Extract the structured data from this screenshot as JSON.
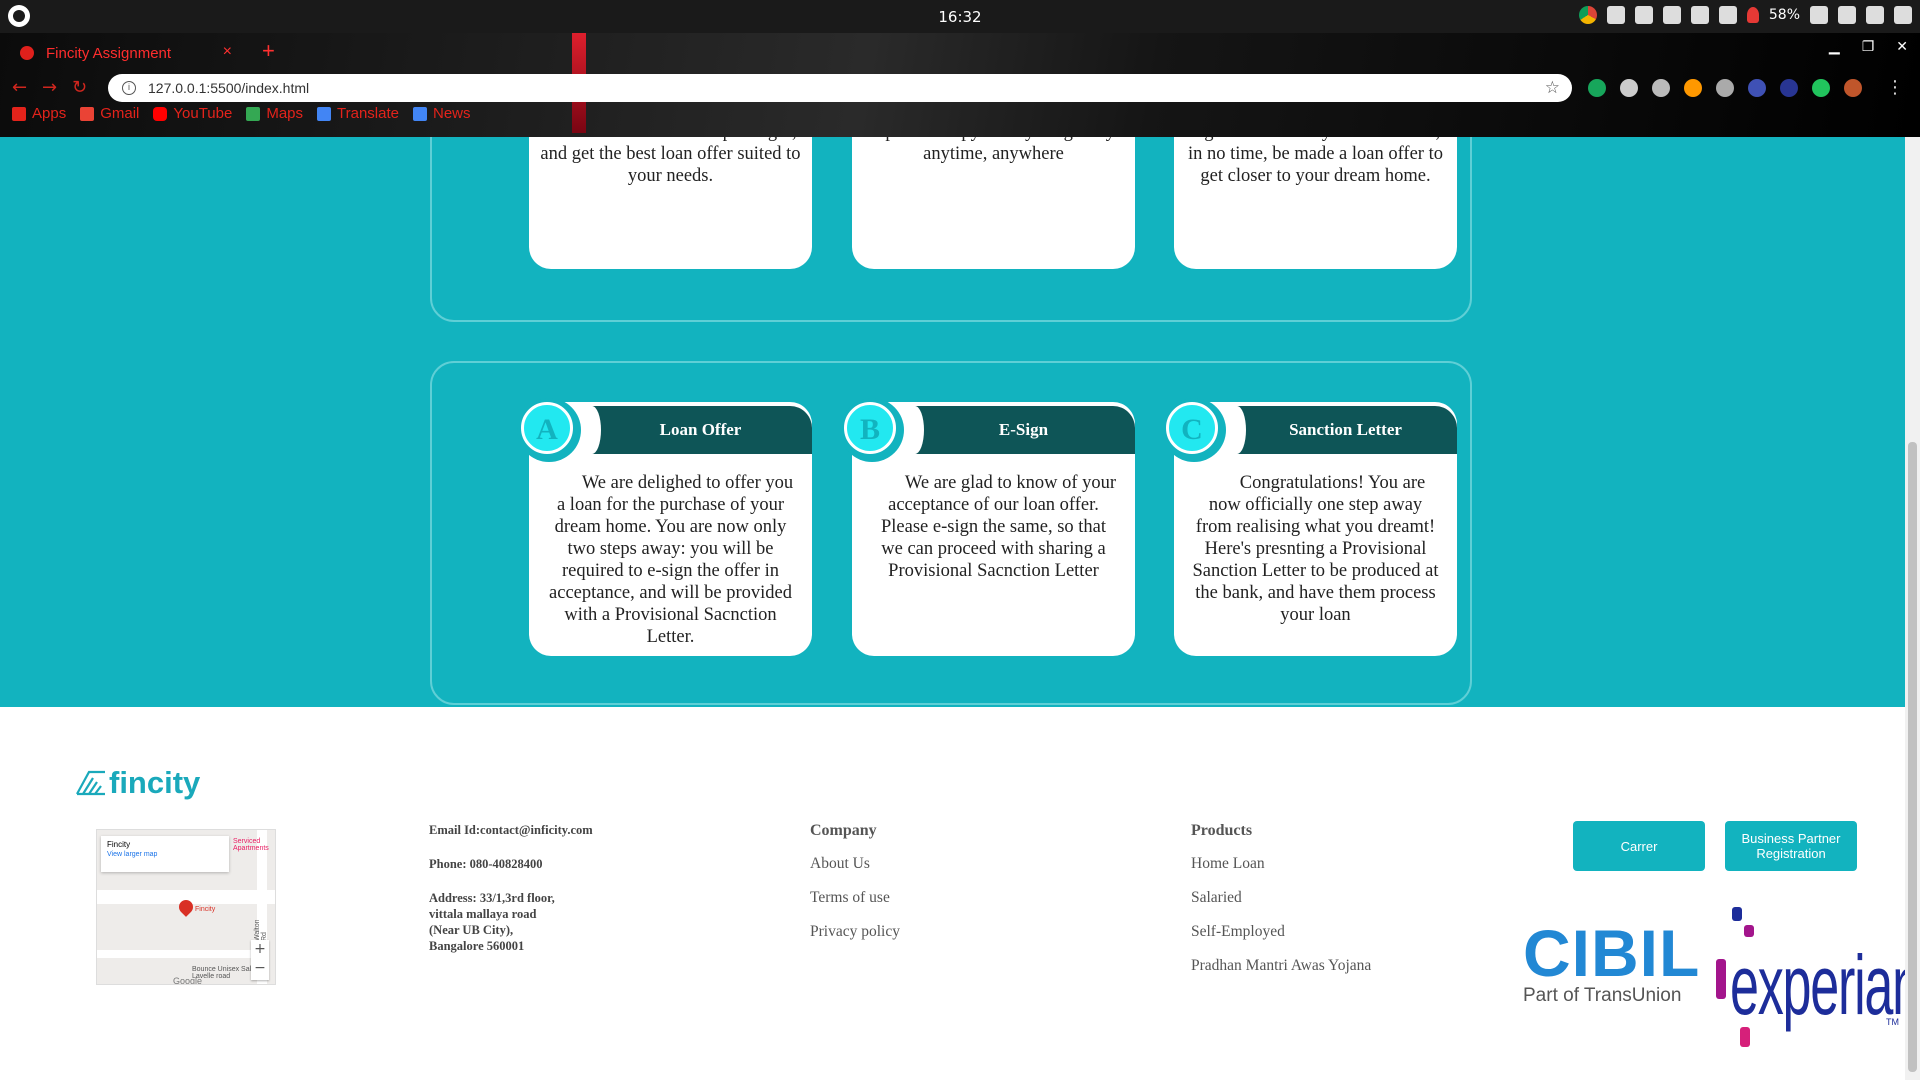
{
  "os": {
    "clock": "16:32",
    "battery": "58%"
  },
  "browser": {
    "tab_title": "Fincity Assignment",
    "tab_close": "×",
    "new_tab": "+",
    "url": "127.0.0.1:5500/index.html",
    "bookmarks": [
      {
        "label": "Apps",
        "icon_color": "#e3231b"
      },
      {
        "label": "Gmail",
        "icon_color": "#ea4335"
      },
      {
        "label": "YouTube",
        "icon_color": "#ff0000"
      },
      {
        "label": "Maps",
        "icon_color": "#34a853"
      },
      {
        "label": "Translate",
        "icon_color": "#4285f4"
      },
      {
        "label": "News",
        "icon_color": "#4285f4"
      }
    ]
  },
  "top_cards": [
    {
      "text": "lenders. In addition, check your Credit Score without impacting it, and get the best loan offer suited to your needs."
    },
    {
      "text": "check for your Credit Score. Upload a copy from your gallery anytime, anywhere"
    },
    {
      "text": "License/ Registered Rent Agreement/ Utility Bill. You will, in no time, be made a loan offer to get closer to your dream home."
    }
  ],
  "steps": [
    {
      "letter": "A",
      "title": "Loan Offer",
      "text": "We are delighed to offer you a loan for the purchase of your dream home. You are now only two steps away: you will be required to e-sign the offer in acceptance, and will be provided with a Provisional Sacnction Letter."
    },
    {
      "letter": "B",
      "title": "E-Sign",
      "text": "We are glad to know of your acceptance of our loan offer. Please e-sign the same, so that we can proceed with sharing a Provisional Sacnction Letter"
    },
    {
      "letter": "C",
      "title": "Sanction Letter",
      "text": "Congratulations! You are now officially one step away from realising what you dreamt! Here's presnting a Provisional Sanction Letter to be produced at the bank, and have them process your loan"
    }
  ],
  "footer": {
    "logo_text": "fincity",
    "map": {
      "place": "Fincity",
      "link": "View larger map",
      "pin_label": "Fincity",
      "nearby": "Bounce Unisex Salon, Lavelle road",
      "road": "Walton Rd",
      "poi": "Serviced Apartments",
      "brand": "Google"
    },
    "contact": {
      "email": "Email Id:contact@inficity.com",
      "phone": "Phone: 080-40828400",
      "address_line1": "Address: 33/1,3rd floor,",
      "address_line2": "vittala mallaya road",
      "address_line3": "(Near UB City),",
      "address_line4": "Bangalore 560001"
    },
    "company": {
      "heading": "Company",
      "links": [
        "About Us",
        "Terms of use",
        "Privacy policy"
      ]
    },
    "products": {
      "heading": "Products",
      "links": [
        "Home Loan",
        "Salaried",
        "Self-Employed",
        "Pradhan Mantri Awas Yojana"
      ]
    },
    "buttons": {
      "career": "Carrer",
      "partner": "Business Partner Registration"
    },
    "cibil": {
      "word": "CIBIL",
      "sub": "Part of TransUnion"
    },
    "experian": {
      "word": "experian",
      "tm": "TM"
    }
  },
  "colors": {
    "teal": "#12b3bf",
    "dark_teal": "#0e5557",
    "accent_cyan": "#22e8f0"
  }
}
